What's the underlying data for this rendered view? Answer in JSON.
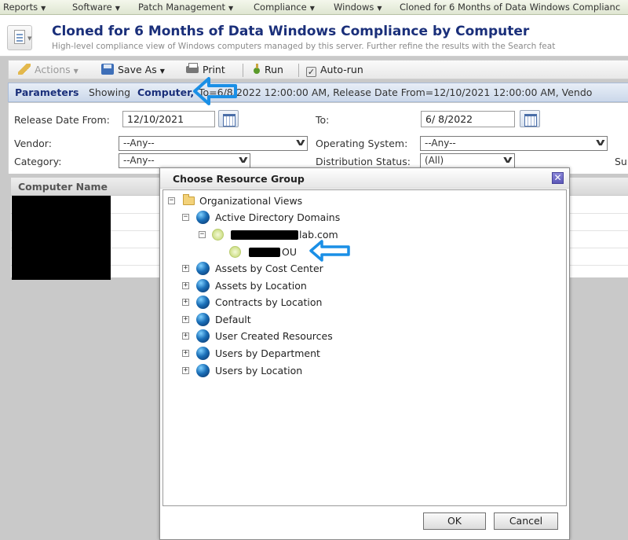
{
  "menu": {
    "items": [
      {
        "label": "Reports",
        "has_caret": true
      },
      {
        "label": "Software",
        "has_caret": true
      },
      {
        "label": "Patch Management",
        "has_caret": true
      },
      {
        "label": "Compliance",
        "has_caret": true
      },
      {
        "label": "Windows",
        "has_caret": true
      },
      {
        "label": "Cloned for 6 Months of Data Windows Complianc",
        "has_caret": false
      }
    ]
  },
  "header": {
    "title": "Cloned for 6 Months of Data Windows Compliance by Computer",
    "subtitle": "High-level compliance view of Windows computers managed by this server. Further refine the results with the Search feat"
  },
  "toolbar": {
    "actions_label": "Actions",
    "save_as_label": "Save As",
    "print_label": "Print",
    "run_label": "Run",
    "auto_run_label": "Auto-run",
    "auto_run_checked": true
  },
  "parameters": {
    "label": "Parameters",
    "showing_prefix": "Showing",
    "showing_link": "Computer,",
    "summary": "To=6/8/2022 12:00:00 AM, Release Date From=12/10/2021 12:00:00 AM, Vendo"
  },
  "form": {
    "release_date_from_label": "Release Date From:",
    "release_date_from_value": "12/10/2021",
    "to_label": "To:",
    "to_value": "6/ 8/2022",
    "vendor_label": "Vendor:",
    "vendor_value": "--Any--",
    "os_label": "Operating System:",
    "os_value": "--Any--",
    "category_label": "Category:",
    "category_value": "--Any--",
    "distribution_status_label": "Distribution Status:",
    "distribution_status_value": "(All)",
    "cut_label": "Su"
  },
  "grid": {
    "columns": [
      "Computer Name"
    ]
  },
  "dialog": {
    "title": "Choose Resource Group",
    "close_glyph": "✕",
    "ok_label": "OK",
    "cancel_label": "Cancel",
    "tree": {
      "root": "Organizational Views",
      "ad_domains": "Active Directory Domains",
      "domain_suffix": "lab.com",
      "ou_suffix": "OU",
      "nodes": [
        "Assets by Cost Center",
        "Assets by Location",
        "Contracts by Location",
        "Default",
        "User Created Resources",
        "Users by Department",
        "Users by Location"
      ]
    }
  },
  "colors": {
    "title_blue": "#1a2f7a",
    "callout_arrow": "#1a8fe6"
  }
}
